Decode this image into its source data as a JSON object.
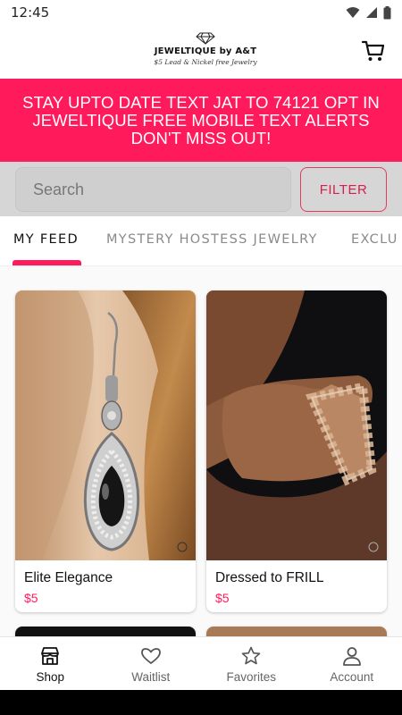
{
  "status_bar": {
    "time": "12:45",
    "icons": [
      "wifi-icon",
      "signal-icon",
      "battery-icon"
    ]
  },
  "header": {
    "logo": {
      "name": "JEWELTIQUE by A&T",
      "tagline": "$5 Lead & Nickel free Jewelry",
      "icon": "diamond-icon"
    },
    "cart_icon": "cart-icon"
  },
  "banner": {
    "text": "STAY UPTO DATE TEXT JAT TO 74121 OPT IN JEWELTIQUE FREE MOBILE TEXT ALERTS DON'T MISS OUT!",
    "color": "#ff1a5c"
  },
  "search": {
    "placeholder": "Search",
    "filter_label": "FILTER"
  },
  "tabs": [
    {
      "label": "MY FEED",
      "active": true
    },
    {
      "label": "MYSTERY HOSTESS JEWELRY",
      "active": false
    },
    {
      "label": "EXCLU",
      "active": false
    }
  ],
  "products": [
    {
      "title": "Elite Elegance",
      "price": "$5"
    },
    {
      "title": "Dressed to FRILL",
      "price": "$5"
    }
  ],
  "bottom_nav": [
    {
      "label": "Shop",
      "icon": "store-icon",
      "active": true
    },
    {
      "label": "Waitlist",
      "icon": "heart-icon",
      "active": false
    },
    {
      "label": "Favorites",
      "icon": "star-icon",
      "active": false
    },
    {
      "label": "Account",
      "icon": "person-icon",
      "active": false
    }
  ],
  "colors": {
    "accent": "#ff1a5c",
    "filter_border": "#e5395f"
  }
}
